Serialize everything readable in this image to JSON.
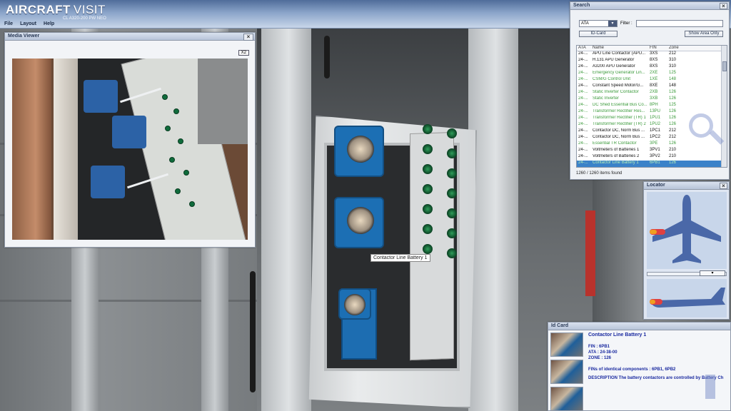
{
  "app": {
    "brand_first": "AIRCRAFT",
    "brand_second": "VISIT",
    "subtitle": "CL A320-200 PW NEO"
  },
  "menu": [
    "File",
    "Layout",
    "Help"
  ],
  "scene": {
    "tooltip": "Contactor Line Battery 1"
  },
  "media_viewer": {
    "title": "Media Viewer",
    "close_icon": "close-icon",
    "zoom_label": "X2"
  },
  "search": {
    "title": "Search",
    "close_icon": "close-icon",
    "type_select": "ATA",
    "filter_label": "Filter :",
    "filter_value": "",
    "id_card_button": "ID-Card",
    "show_area_button": "Show Area Only",
    "columns": [
      "ATA",
      "Name",
      "FIN",
      "Zone"
    ],
    "rows": [
      {
        "ata": "24-...",
        "name": "APU Line Contactor (APU...",
        "fin": "3XS",
        "zone": "212",
        "color": "black"
      },
      {
        "ata": "24-...",
        "name": "H.131 APU Generator",
        "fin": "8XS",
        "zone": "310",
        "color": "black"
      },
      {
        "ata": "24-...",
        "name": "A3200 APU Generator",
        "fin": "8XS",
        "zone": "310",
        "color": "black"
      },
      {
        "ata": "24-...",
        "name": "Emergency Generator Lin...",
        "fin": "2XE",
        "zone": "125",
        "color": "green"
      },
      {
        "ata": "24-...",
        "name": "CSM/G Control Unit",
        "fin": "1XE",
        "zone": "148",
        "color": "green"
      },
      {
        "ata": "24-...",
        "name": "Constant Speed Motor/G...",
        "fin": "8XE",
        "zone": "148",
        "color": "black"
      },
      {
        "ata": "24-...",
        "name": "Static Inverter Contactor",
        "fin": "2XB",
        "zone": "126",
        "color": "green"
      },
      {
        "ata": "24-...",
        "name": "Static Inverter",
        "fin": "3XB",
        "zone": "126",
        "color": "green"
      },
      {
        "ata": "24-...",
        "name": "DC Shed Essential Bus Co...",
        "fin": "8PH",
        "zone": "125",
        "color": "green"
      },
      {
        "ata": "24-...",
        "name": "Transformer Rectifier Res...",
        "fin": "13PU",
        "zone": "126",
        "color": "green"
      },
      {
        "ata": "24-...",
        "name": "Transformer Rectifier (TR) 1",
        "fin": "1PU1",
        "zone": "126",
        "color": "green"
      },
      {
        "ata": "24-...",
        "name": "Transformer Rectifier (TR) 2",
        "fin": "1PU2",
        "zone": "126",
        "color": "green"
      },
      {
        "ata": "24-...",
        "name": "Contactor DC, Norm Bus ...",
        "fin": "1PC1",
        "zone": "212",
        "color": "black"
      },
      {
        "ata": "24-...",
        "name": "Contactor DC, Norm Bus ...",
        "fin": "1PC2",
        "zone": "212",
        "color": "black"
      },
      {
        "ata": "24-...",
        "name": "Essential TR Contactor",
        "fin": "3PE",
        "zone": "126",
        "color": "green"
      },
      {
        "ata": "24-...",
        "name": "Voltmeters of Batteries 1",
        "fin": "3PV1",
        "zone": "210",
        "color": "black"
      },
      {
        "ata": "24-...",
        "name": "Voltmeters of Batteries 2",
        "fin": "3PV2",
        "zone": "210",
        "color": "black"
      },
      {
        "ata": "24-...",
        "name": "Contactor Line Battery 1",
        "fin": "6PB1",
        "zone": "126",
        "color": "selected"
      }
    ],
    "count_text": "1260 / 1260 items found",
    "magnifier_icon": "magnifier-icon"
  },
  "locator": {
    "title": "Locator",
    "close_icon": "close-icon",
    "slider_icon": "chevron-down-icon"
  },
  "id_card": {
    "title": "Id Card",
    "component_name": "Contactor Line Battery 1",
    "fin_line": "FIN : 6PB1",
    "ata_line": "ATA : 24-38-00",
    "zone_line": "ZONE : 126",
    "identical_line": "FINs of identical components : 6PB1, 6PB2",
    "description_line": "DESCRIPTION The battery contactors are controlled by Battery Ch"
  },
  "colors": {
    "header_gradient_top": "#4f6c9a",
    "list_green": "#3a9a3a",
    "selection_blue": "#3b82c9",
    "idcard_text": "#1a2aa0",
    "relay_blue": "#1c6fb4",
    "aircraft_blue": "#4a68a8"
  }
}
